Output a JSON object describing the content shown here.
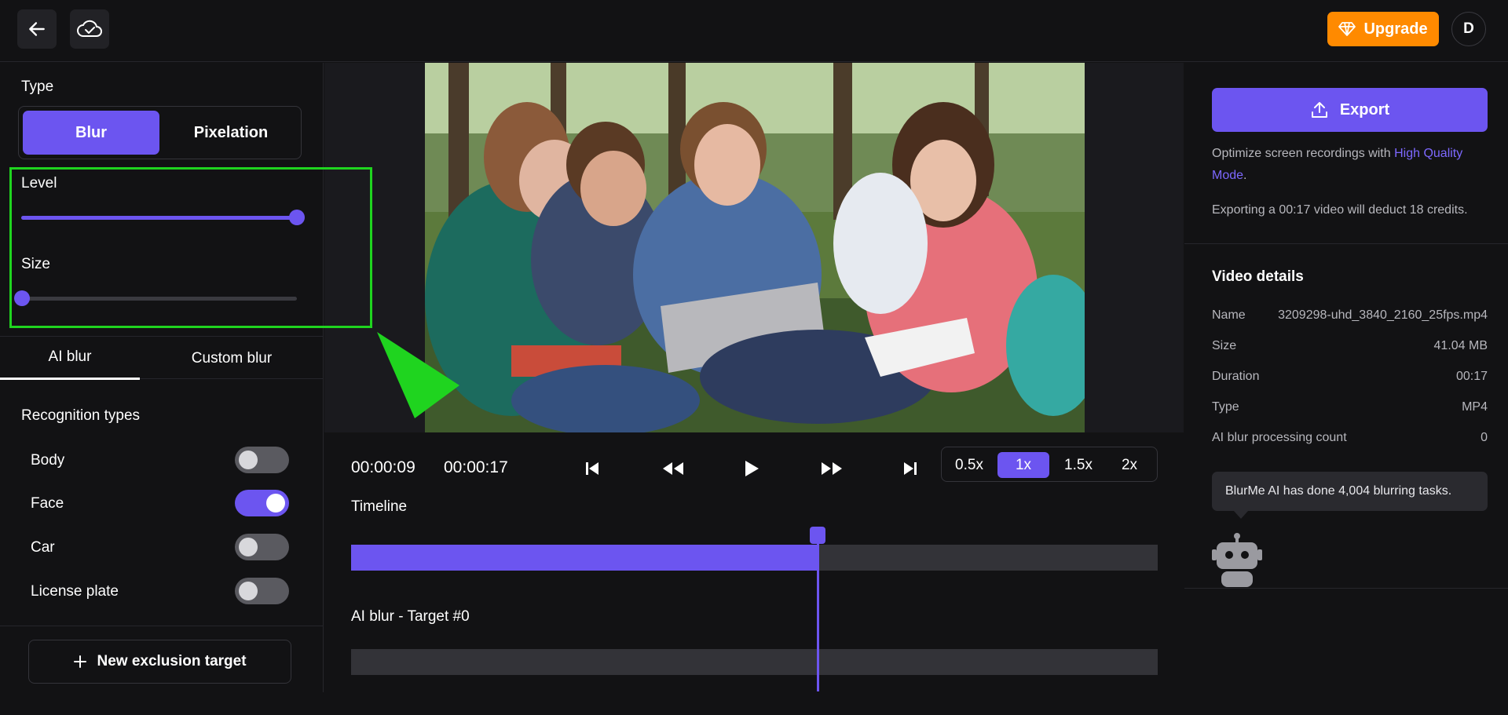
{
  "topbar": {
    "back_icon": "arrow-left-icon",
    "cloud_icon": "cloud-check-icon",
    "upgrade_label": "Upgrade",
    "avatar_initial": "D"
  },
  "left": {
    "type_label": "Type",
    "type_options": [
      "Blur",
      "Pixelation"
    ],
    "type_selected": "Blur",
    "level_label": "Level",
    "level_value": 1.0,
    "size_label": "Size",
    "size_value": 0.0,
    "tabs": [
      "AI blur",
      "Custom blur"
    ],
    "active_tab": "AI blur",
    "recognition_title": "Recognition types",
    "recognition": [
      {
        "name": "Body",
        "on": false
      },
      {
        "name": "Face",
        "on": true
      },
      {
        "name": "Car",
        "on": false
      },
      {
        "name": "License plate",
        "on": false
      }
    ],
    "new_exclusion_label": "New exclusion target"
  },
  "player": {
    "current_time": "00:00:09",
    "total_time": "00:00:17",
    "speeds": [
      "0.5x",
      "1x",
      "1.5x",
      "2x"
    ],
    "speed_selected": "1x",
    "timeline_label": "Timeline",
    "target_label": "AI blur - Target #0",
    "progress": 0.578
  },
  "right": {
    "export_label": "Export",
    "optimize_text": "Optimize screen recordings with ",
    "optimize_link": "High Quality Mode",
    "optimize_end": ".",
    "deduct_text": "Exporting a 00:17 video will deduct 18 credits.",
    "details_title": "Video details",
    "details": [
      {
        "key": "Name",
        "value": "3209298-uhd_3840_2160_25fps.mp4"
      },
      {
        "key": "Size",
        "value": "41.04 MB"
      },
      {
        "key": "Duration",
        "value": "00:17"
      },
      {
        "key": "Type",
        "value": "MP4"
      },
      {
        "key": "AI blur processing count",
        "value": "0"
      }
    ],
    "bubble_text": "BlurMe AI has done 4,004 blurring tasks."
  },
  "colors": {
    "accent": "#6c55f0",
    "upgrade": "#ff8a00",
    "highlight": "#1fd41f"
  }
}
